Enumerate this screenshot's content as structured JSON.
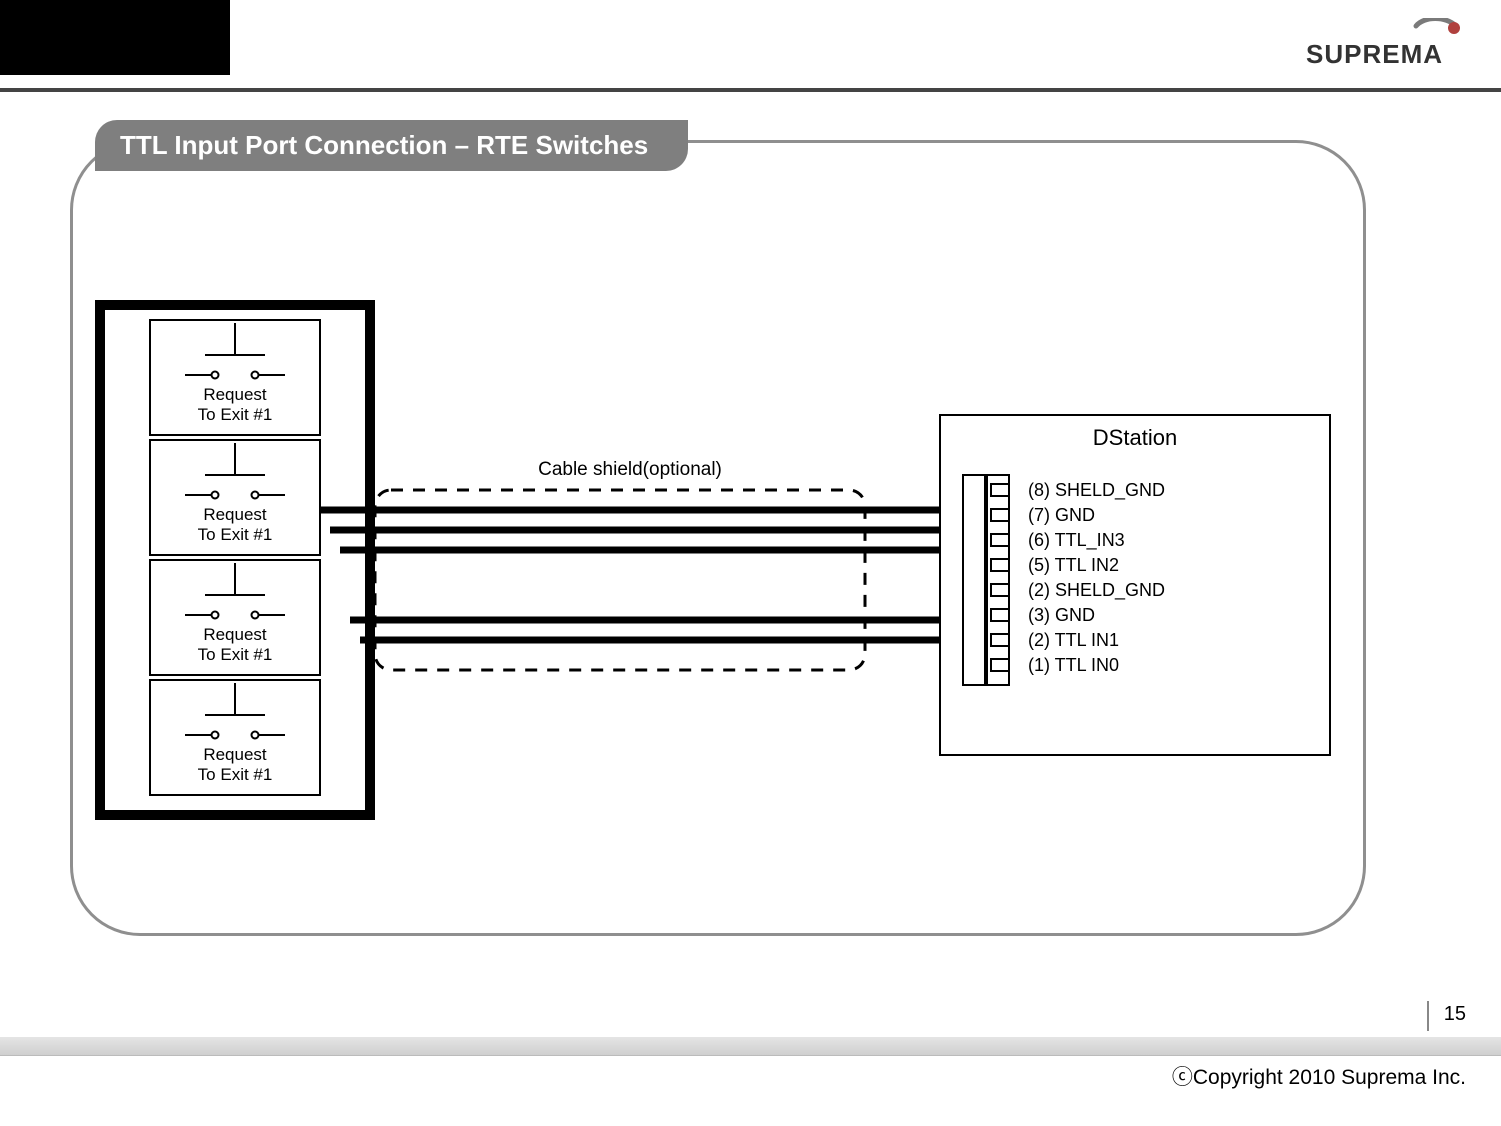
{
  "header": {
    "logo_name": "SUPREMA"
  },
  "title": "TTL Input Port Connection – RTE Switches",
  "left_switches": [
    {
      "line1": "Request",
      "line2": "To Exit #1"
    },
    {
      "line1": "Request",
      "line2": "To Exit #1"
    },
    {
      "line1": "Request",
      "line2": "To Exit #1"
    },
    {
      "line1": "Request",
      "line2": "To Exit #1"
    }
  ],
  "cable_shield_label": "Cable shield(optional)",
  "dstation": {
    "title": "DStation",
    "pins": [
      "(8) SHELD_GND",
      "(7) GND",
      "(6) TTL_IN3",
      "(5) TTL IN2",
      "(2) SHELD_GND",
      "(3) GND",
      "(2) TTL IN1",
      "(1) TTL IN0"
    ]
  },
  "footer": {
    "page_number": "15",
    "copyright": "ⓒCopyright 2010 Suprema Inc."
  }
}
